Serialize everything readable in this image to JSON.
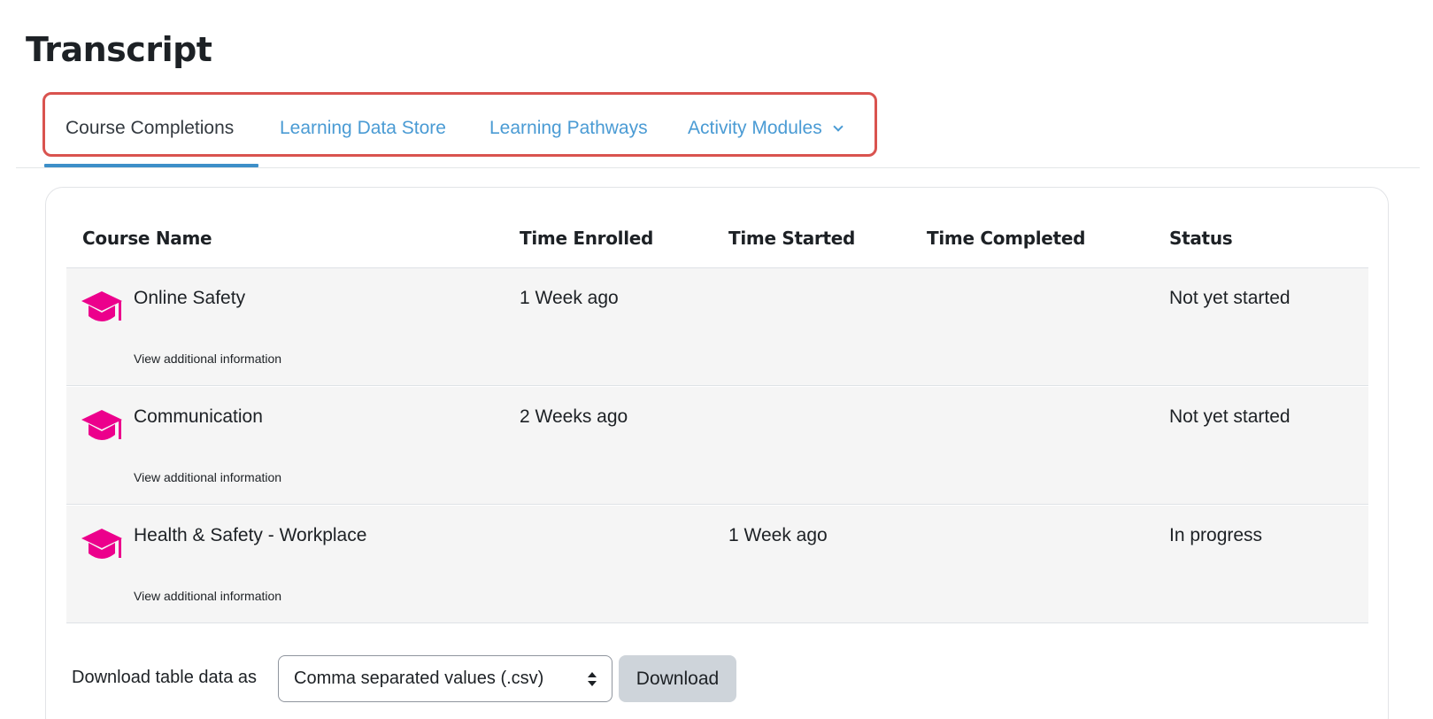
{
  "page": {
    "title": "Transcript"
  },
  "tabs": [
    {
      "label": "Course Completions",
      "active": true
    },
    {
      "label": "Learning Data Store",
      "active": false
    },
    {
      "label": "Learning Pathways",
      "active": false
    },
    {
      "label": "Activity Modules",
      "active": false,
      "dropdown": true
    }
  ],
  "table": {
    "columns": [
      "Course Name",
      "Time Enrolled",
      "Time Started",
      "Time Completed",
      "Status"
    ],
    "rows": [
      {
        "course": "Online Safety",
        "enrolled": "1 Week ago",
        "started": "",
        "completed": "",
        "status": "Not yet started",
        "more": "View additional information"
      },
      {
        "course": "Communication",
        "enrolled": "2 Weeks ago",
        "started": "",
        "completed": "",
        "status": "Not yet started",
        "more": "View additional information"
      },
      {
        "course": "Health & Safety - Workplace",
        "enrolled": "",
        "started": "1 Week ago",
        "completed": "",
        "status": "In progress",
        "more": "View additional information"
      }
    ]
  },
  "download": {
    "label": "Download table data as",
    "selected_format": "Comma separated values (.csv)",
    "button_label": "Download"
  },
  "colors": {
    "course_icon": "#ec008c",
    "tab_link": "#4a9bd4",
    "highlight_border": "#d9534f"
  },
  "icons": {
    "course": "graduation-cap-icon",
    "dropdown": "chevron-down-icon",
    "select": "sort-arrows-icon"
  }
}
